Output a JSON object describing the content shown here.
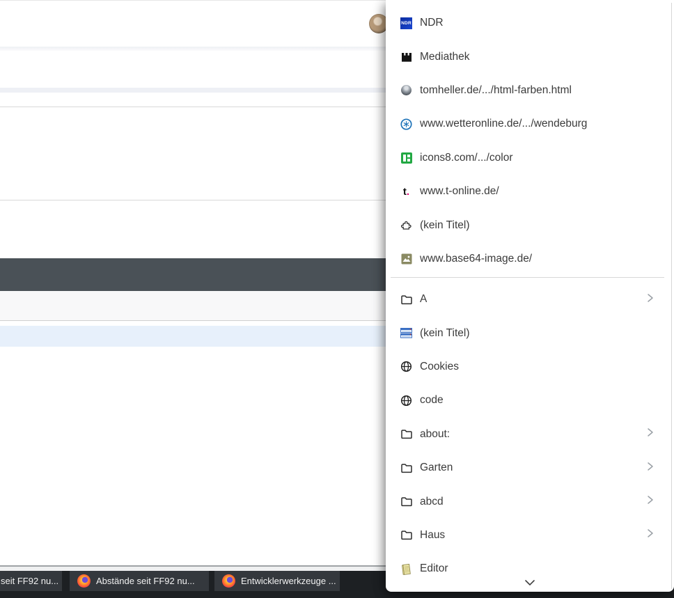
{
  "bookmarks_menu": {
    "items": [
      {
        "label": "NDR",
        "icon": "ndr-logo-icon"
      },
      {
        "label": "Mediathek",
        "icon": "mediathek-logo-icon"
      },
      {
        "label": "tomheller.de/.../html-farben.html",
        "icon": "gray-sphere-favicon"
      },
      {
        "label": "www.wetteronline.de/.../wendeburg",
        "icon": "wetteronline-favicon"
      },
      {
        "label": "icons8.com/.../color",
        "icon": "icons8-favicon"
      },
      {
        "label": "www.t-online.de/",
        "icon": "t-online-favicon"
      },
      {
        "label": "(kein Titel)",
        "icon": "puzzle-icon"
      },
      {
        "label": "www.base64-image.de/",
        "icon": "image-favicon"
      }
    ],
    "folder_items": [
      {
        "label": "A",
        "icon": "folder-icon",
        "has_submenu": true
      },
      {
        "label": "(kein Titel)",
        "icon": "striped-window-favicon",
        "has_submenu": false
      },
      {
        "label": "Cookies",
        "icon": "globe-icon",
        "has_submenu": false
      },
      {
        "label": "code",
        "icon": "globe-icon",
        "has_submenu": false
      },
      {
        "label": "about:",
        "icon": "folder-icon",
        "has_submenu": true
      },
      {
        "label": "Garten",
        "icon": "folder-icon",
        "has_submenu": true
      },
      {
        "label": "abcd",
        "icon": "folder-icon",
        "has_submenu": true
      },
      {
        "label": "Haus",
        "icon": "folder-icon",
        "has_submenu": true
      },
      {
        "label": "Editor",
        "icon": "notepad-icon",
        "has_submenu": false
      }
    ],
    "ndr_icon_text": "NDR",
    "t_online_glyph": "t",
    "t_online_dot": "."
  },
  "taskbar": {
    "buttons": [
      {
        "label": "seit FF92 nu...",
        "icon": null
      },
      {
        "label": "Abstände seit FF92 nu...",
        "icon": "firefox-icon"
      },
      {
        "label": "Entwicklerwerkzeuge ...",
        "icon": "firefox-icon"
      }
    ]
  },
  "colors": {
    "menu_background": "#ffffff",
    "menu_text": "#3b3b3b",
    "page_dark_bar": "#4a5157",
    "page_selected_row_blue": "#e7f0fb",
    "taskbar_background": "#1d2023",
    "taskbar_button": "#34383d",
    "taskbar_underline": "#a9b1b6",
    "ndr_blue": "#1a46d0",
    "icons8_green": "#22a843",
    "t_online_magenta": "#e20074"
  }
}
